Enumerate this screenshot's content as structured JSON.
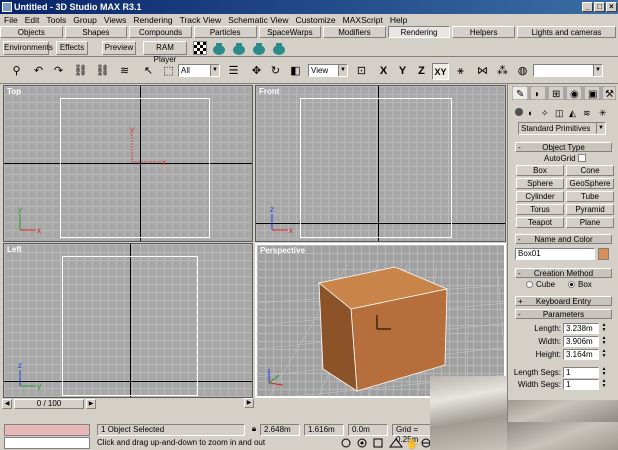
{
  "window": {
    "title": "Untitled - 3D Studio MAX R3.1",
    "controls": [
      "_",
      "□",
      "×"
    ]
  },
  "menu": [
    "File",
    "Edit",
    "Tools",
    "Group",
    "Views",
    "Rendering",
    "Track View",
    "Schematic View",
    "Customize",
    "MAXScript",
    "Help"
  ],
  "tabs": [
    {
      "label": "Objects"
    },
    {
      "label": "Shapes"
    },
    {
      "label": "Compounds"
    },
    {
      "label": "Particles"
    },
    {
      "label": "SpaceWarps"
    },
    {
      "label": "Modifiers"
    },
    {
      "label": "Rendering",
      "active": true
    },
    {
      "label": "Helpers"
    },
    {
      "label": "Lights and cameras"
    }
  ],
  "subtoolbar": {
    "environments": "Environments",
    "effects": "Effects",
    "preview": "Preview",
    "ram_player": "RAM Player"
  },
  "maintoolbar": {
    "selection_filter": "All",
    "coord_system": "View",
    "axis_x": "X",
    "axis_y": "Y",
    "axis_z": "Z",
    "axis_xy": "XY",
    "named_selection": ""
  },
  "viewports": {
    "top": "Top",
    "front": "Front",
    "left": "Left",
    "perspective": "Perspective"
  },
  "command_panel": {
    "category": "Standard Primitives",
    "object_type_title": "Object Type",
    "autogrid": "AutoGrid",
    "primitives": [
      "Box",
      "Cone",
      "Sphere",
      "GeoSphere",
      "Cylinder",
      "Tube",
      "Torus",
      "Pyramid",
      "Teapot",
      "Plane"
    ],
    "name_color_title": "Name and Color",
    "object_name": "Box01",
    "object_color": "#d89058",
    "creation_method_title": "Creation Method",
    "creation_cube": "Cube",
    "creation_box": "Box",
    "keyboard_entry_title": "Keyboard Entry",
    "parameters_title": "Parameters",
    "length_label": "Length:",
    "length_value": "3.238m",
    "width_label": "Width:",
    "width_value": "3.906m",
    "height_label": "Height:",
    "height_value": "3.164m",
    "length_segs_label": "Length Segs:",
    "length_segs_value": "1",
    "width_segs_label": "Width Segs:",
    "width_segs_value": "1"
  },
  "timeline": {
    "frame": "0 / 100"
  },
  "status": {
    "selected": "1 Object Selected",
    "prompt": "Click and drag up-and-down to zoom in and out",
    "x": "2.648m",
    "y": "1.616m",
    "z": "0.0m",
    "grid": "Grid = 0.25m"
  },
  "colors": {
    "box_front": "#b66f3c",
    "box_side": "#8c5228",
    "box_top": "#c98449",
    "selection_bracket": "#ffffff",
    "axis_x": "#e02020",
    "axis_y": "#20a020",
    "axis_z": "#2040e0"
  }
}
